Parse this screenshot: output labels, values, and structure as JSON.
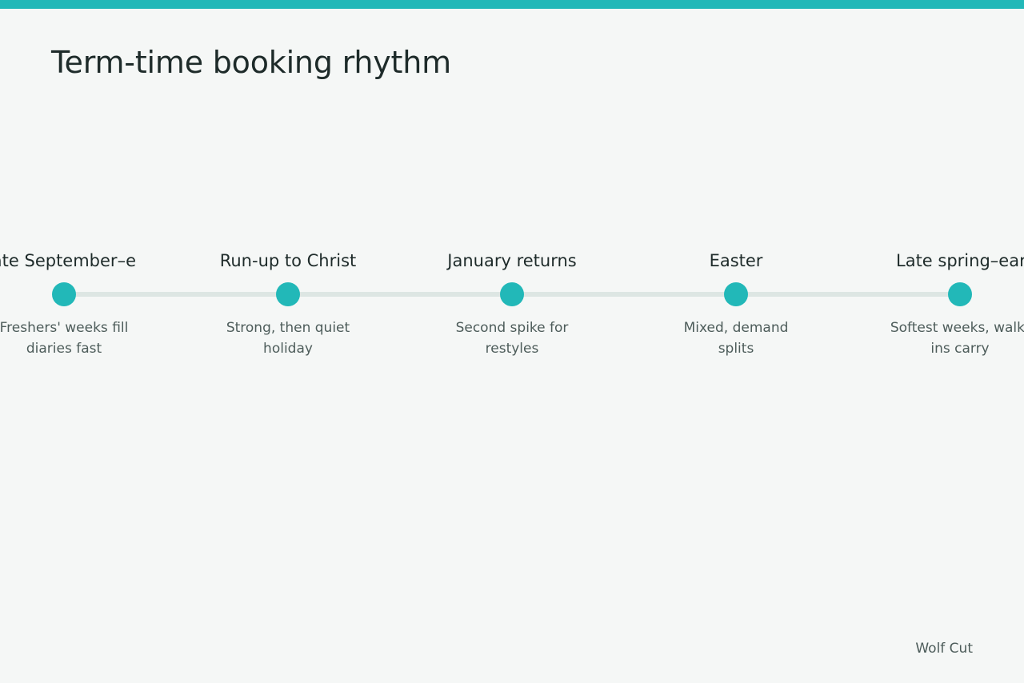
{
  "title": "Term-time booking rhythm",
  "accent_color": "#22b8b8",
  "track_color": "#dde6e3",
  "milestones": [
    {
      "label": "Late September–e",
      "note": "Freshers' weeks fill diaries fast"
    },
    {
      "label": "Run-up to Christ",
      "note": "Strong, then quiet holiday"
    },
    {
      "label": "January returns",
      "note": "Second spike for restyles"
    },
    {
      "label": "Easter",
      "note": "Mixed, demand splits"
    },
    {
      "label": "Late spring–earl",
      "note": "Softest weeks, walk-ins carry"
    }
  ],
  "footer": "Wolf Cut"
}
